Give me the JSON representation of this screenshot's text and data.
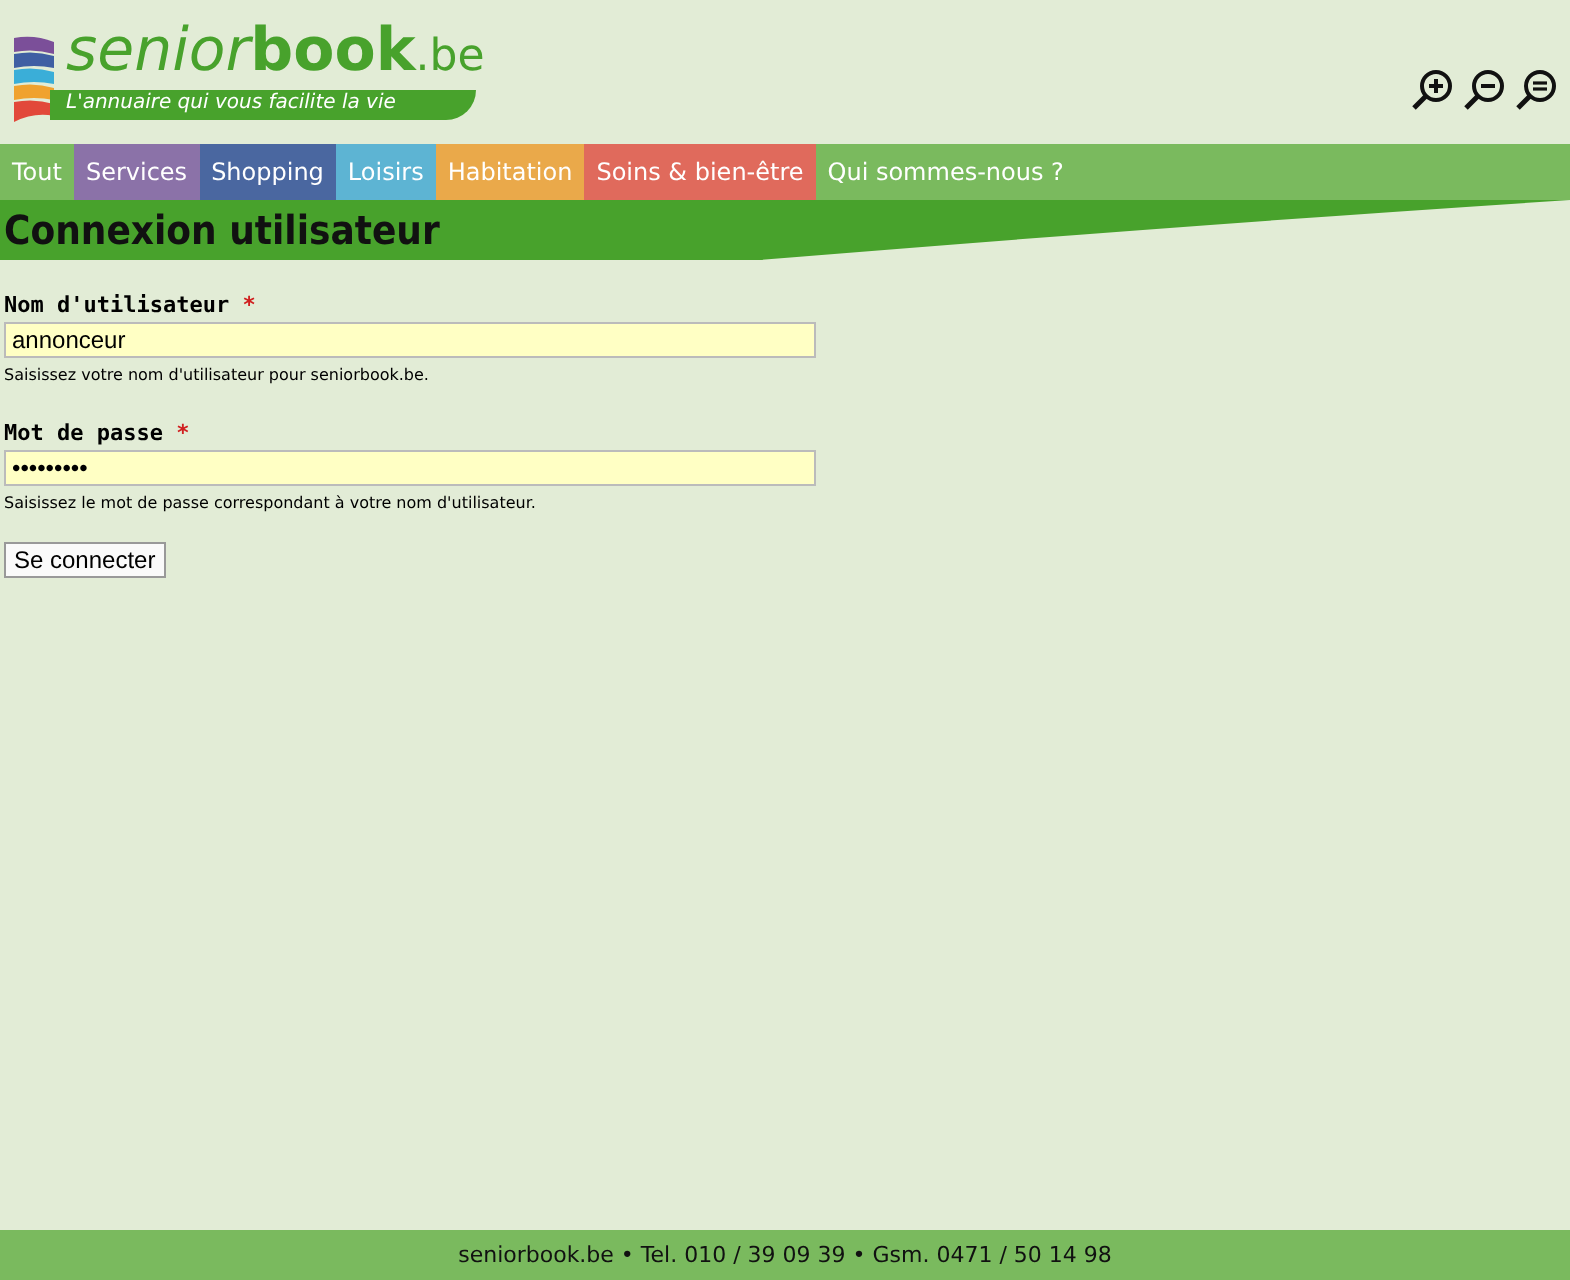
{
  "logo": {
    "name_light": "senior",
    "name_bold": "book",
    "suffix": ".be",
    "tagline": "L'annuaire qui vous facilite la vie"
  },
  "zoom_buttons": [
    {
      "kind": "in"
    },
    {
      "kind": "out"
    },
    {
      "kind": "reset"
    }
  ],
  "nav": [
    {
      "label": "Tout",
      "color": "#7aba5e"
    },
    {
      "label": "Services",
      "color": "#8b72a8"
    },
    {
      "label": "Shopping",
      "color": "#4a67a0"
    },
    {
      "label": "Loisirs",
      "color": "#5db4d3"
    },
    {
      "label": "Habitation",
      "color": "#eaa94a"
    },
    {
      "label": "Soins & bien-être",
      "color": "#e06a5c"
    },
    {
      "label": "Qui sommes-nous ?",
      "color": "#7aba5e"
    }
  ],
  "page_title": "Connexion utilisateur",
  "fields": [
    {
      "label": "Nom d'utilisateur",
      "required": "*",
      "value": "annonceur",
      "help": "Saisissez votre nom d'utilisateur pour seniorbook.be."
    },
    {
      "label": "Mot de passe",
      "required": "*",
      "value": "•••••••••",
      "help": "Saisissez le mot de passe correspondant à votre nom d'utilisateur."
    }
  ],
  "submit": "Se connecter",
  "footer": "seniorbook.be • Tel. 010 / 39 09 39 • Gsm. 0471 / 50 14 98"
}
